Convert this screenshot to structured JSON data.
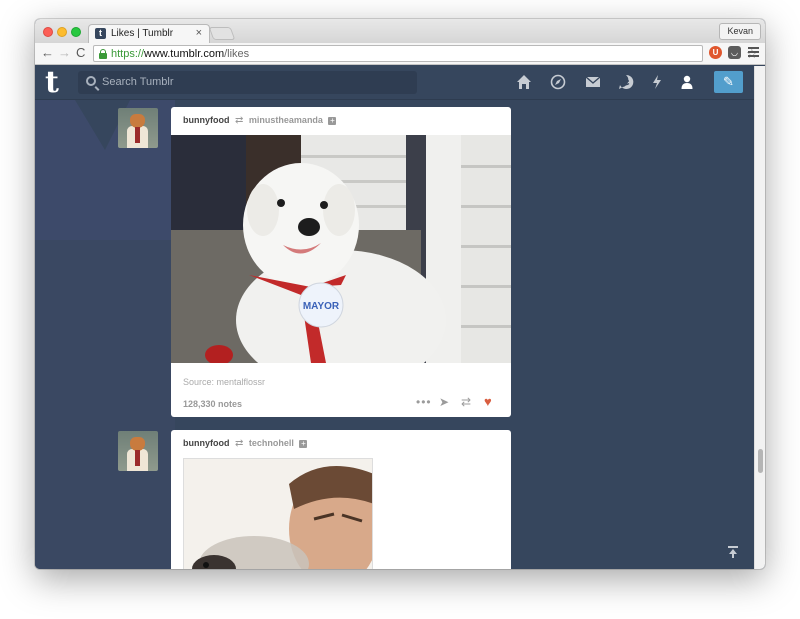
{
  "browser": {
    "tab_title": "Likes | Tumblr",
    "tab_close": "×",
    "profile": "Kevan",
    "url_scheme": "https://",
    "url_host": "www.tumblr.com",
    "url_path": "/likes",
    "nav": {
      "back": "←",
      "forward": "→",
      "reload": "C"
    }
  },
  "tumblr": {
    "logo": "t",
    "search_placeholder": "Search Tumblr",
    "brand_color": "#36465d",
    "accent_color": "#529ecc"
  },
  "posts": [
    {
      "user": "bunnyfood",
      "reblogged_from": "minustheamanda",
      "photo_badge": "MAYOR",
      "source": "Source: mentalflossr",
      "notes": "128,330 notes",
      "liked": true
    },
    {
      "user": "bunnyfood",
      "reblogged_from": "technohell"
    }
  ],
  "icons": {
    "reblog": "⇄",
    "follow": "+",
    "more": "•••",
    "share": "➤",
    "heart": "♥",
    "compose": "✎"
  }
}
